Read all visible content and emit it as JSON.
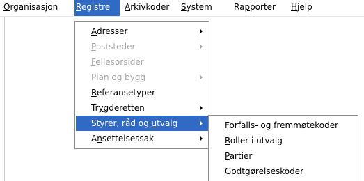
{
  "menubar": {
    "items": [
      {
        "pre": "",
        "acc": "O",
        "post": "rganisasjon"
      },
      {
        "pre": "",
        "acc": "R",
        "post": "egistre"
      },
      {
        "pre": "",
        "acc": "A",
        "post": "rkivkoder"
      },
      {
        "pre": "",
        "acc": "S",
        "post": "ystem"
      },
      {
        "pre": "Ra",
        "acc": "p",
        "post": "porter"
      },
      {
        "pre": "",
        "acc": "H",
        "post": "jelp"
      }
    ]
  },
  "registre_menu": {
    "items": [
      {
        "pre": "",
        "acc": "A",
        "post": "dresser"
      },
      {
        "pre": "",
        "acc": "P",
        "post": "oststeder"
      },
      {
        "pre": "",
        "acc": "F",
        "post": "ellesorsider"
      },
      {
        "pre": "P",
        "acc": "l",
        "post": "an og bygg"
      },
      {
        "pre": "",
        "acc": "R",
        "post": "eferansetyper"
      },
      {
        "pre": "Tr",
        "acc": "y",
        "post": "gderetten"
      },
      {
        "pre": "Styrer, råd og ",
        "acc": "u",
        "post": "tvalg"
      },
      {
        "pre": "A",
        "acc": "n",
        "post": "settelsessak"
      }
    ]
  },
  "styrer_submenu": {
    "items": [
      {
        "pre": "",
        "acc": "F",
        "post": "orfalls- og fremmøtekoder"
      },
      {
        "pre": "",
        "acc": "R",
        "post": "oller i utvalg"
      },
      {
        "pre": "",
        "acc": "P",
        "post": "artier"
      },
      {
        "pre": "",
        "acc": "G",
        "post": "odtgørelseskoder"
      }
    ]
  },
  "colors": {
    "highlight": "#316ac5",
    "disabled": "#a6a6a6"
  }
}
